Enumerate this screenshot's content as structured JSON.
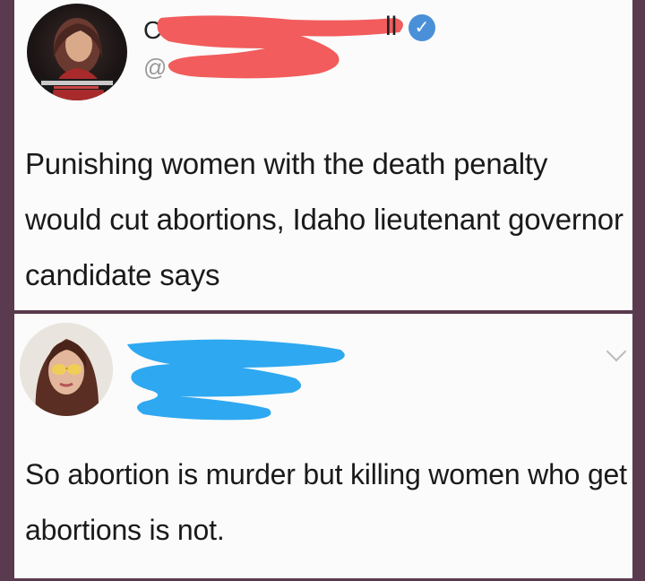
{
  "tweets": [
    {
      "avatar": "profile-photo-woman-dark-background",
      "name_visible_head": "C",
      "name_visible_tail": "ll",
      "handle_visible": "@",
      "verified": true,
      "redaction_color": "#f25c5c",
      "text": "Punishing women with the death penalty would cut abortions, Idaho lieutenant governor candidate says"
    },
    {
      "avatar": "profile-photo-woman-sunglasses",
      "redaction_color": "#2ea8f0",
      "text": "So abortion is murder but killing women who get abortions is not."
    }
  ],
  "colors": {
    "border": "#5a3a4e",
    "card": "#fbfbfb",
    "verified": "#4a90d9"
  }
}
